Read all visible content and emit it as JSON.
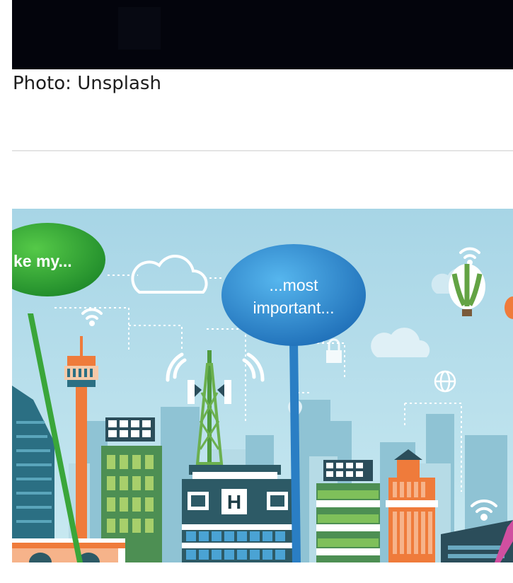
{
  "caption": "Photo: Unsplash",
  "illustration": {
    "bubble_left_text": "ke my...",
    "bubble_center_line1": "...most",
    "bubble_center_line2": "important...",
    "hospital_sign": "H"
  },
  "colors": {
    "sky": "#a9d6e6",
    "green_bubble": "#3db33a",
    "blue_bubble": "#2a8fd4",
    "top_image_bg": "#03040c"
  }
}
